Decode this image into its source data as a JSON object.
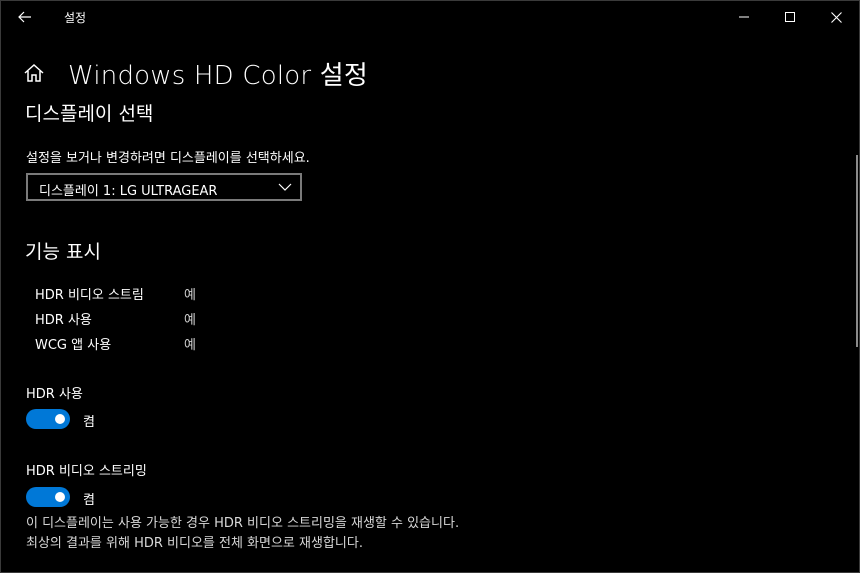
{
  "titlebar": {
    "app_title": "설정",
    "back_icon": "back-arrow-icon",
    "minimize_icon": "minimize-icon",
    "maximize_icon": "maximize-icon",
    "close_icon": "close-icon"
  },
  "header": {
    "home_icon": "home-icon",
    "title": "Windows HD Color 설정"
  },
  "display_select": {
    "heading": "디스플레이 선택",
    "description": "설정을 보거나 변경하려면 디스플레이를 선택하세요.",
    "selected": "디스플레이 1: LG ULTRAGEAR"
  },
  "capabilities": {
    "heading": "기능 표시",
    "rows": [
      {
        "label": "HDR 비디오 스트림",
        "value": "예"
      },
      {
        "label": "HDR 사용",
        "value": "예"
      },
      {
        "label": "WCG 앱 사용",
        "value": "예"
      }
    ]
  },
  "toggles": [
    {
      "label": "HDR 사용",
      "state": "켬",
      "on": true
    },
    {
      "label": "HDR 비디오 스트리밍",
      "state": "켬",
      "on": true
    }
  ],
  "footnote": "이 디스플레이는 사용 가능한 경우 HDR 비디오 스트리밍을 재생할 수 있습니다. 최상의 결과를 위해 HDR 비디오를 전체 화면으로 재생합니다.",
  "colors": {
    "background": "#000000",
    "accent": "#0078d7",
    "text": "#ffffff",
    "border": "#7a7a7a"
  }
}
